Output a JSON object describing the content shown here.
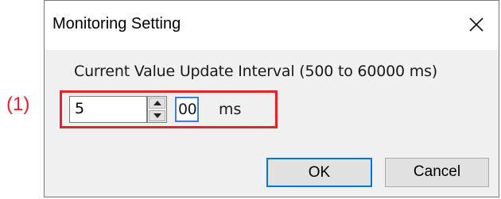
{
  "annotation": {
    "label": "(1)"
  },
  "dialog": {
    "title": "Monitoring Setting",
    "close_icon": "close-icon"
  },
  "form": {
    "prompt": "Current Value Update Interval (500 to 60000 ms)",
    "value": "5",
    "suffix": "00",
    "unit": "ms"
  },
  "buttons": {
    "ok_label": "OK",
    "cancel_label": "Cancel"
  },
  "colors": {
    "annotation": "#e8202a",
    "focus": "#0078d7",
    "dialog_bg": "#f0f0f0"
  }
}
